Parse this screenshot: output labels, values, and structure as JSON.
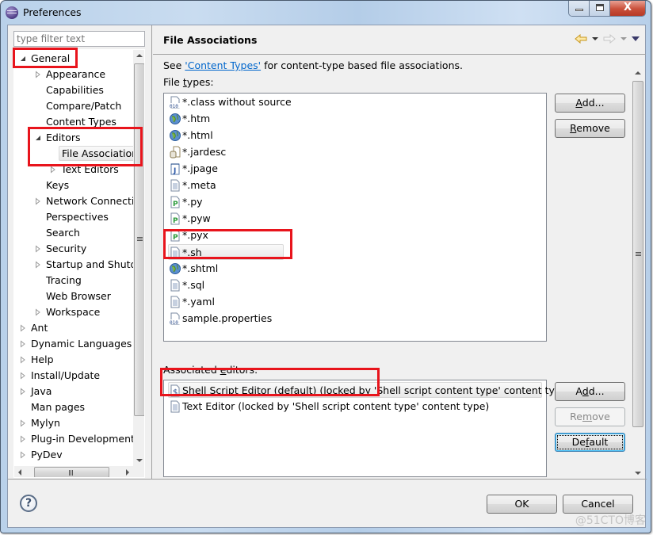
{
  "window": {
    "title": "Preferences",
    "close_glyph": "X"
  },
  "filter": {
    "placeholder": "type filter text"
  },
  "tree": {
    "nodes": [
      {
        "label": "General",
        "level": 0,
        "state": "expanded"
      },
      {
        "label": "Appearance",
        "level": 1,
        "state": "collapsed"
      },
      {
        "label": "Capabilities",
        "level": 1,
        "state": "leaf"
      },
      {
        "label": "Compare/Patch",
        "level": 1,
        "state": "leaf"
      },
      {
        "label": "Content Types",
        "level": 1,
        "state": "leaf"
      },
      {
        "label": "Editors",
        "level": 1,
        "state": "expanded"
      },
      {
        "label": "File Associations",
        "level": 2,
        "state": "leaf",
        "selected": true
      },
      {
        "label": "Text Editors",
        "level": 2,
        "state": "collapsed"
      },
      {
        "label": "Keys",
        "level": 1,
        "state": "leaf"
      },
      {
        "label": "Network Connections",
        "level": 1,
        "state": "collapsed"
      },
      {
        "label": "Perspectives",
        "level": 1,
        "state": "leaf"
      },
      {
        "label": "Search",
        "level": 1,
        "state": "leaf"
      },
      {
        "label": "Security",
        "level": 1,
        "state": "collapsed"
      },
      {
        "label": "Startup and Shutdown",
        "level": 1,
        "state": "collapsed"
      },
      {
        "label": "Tracing",
        "level": 1,
        "state": "leaf"
      },
      {
        "label": "Web Browser",
        "level": 1,
        "state": "leaf"
      },
      {
        "label": "Workspace",
        "level": 1,
        "state": "collapsed"
      },
      {
        "label": "Ant",
        "level": 0,
        "state": "collapsed"
      },
      {
        "label": "Dynamic Languages",
        "level": 0,
        "state": "collapsed"
      },
      {
        "label": "Help",
        "level": 0,
        "state": "collapsed"
      },
      {
        "label": "Install/Update",
        "level": 0,
        "state": "collapsed"
      },
      {
        "label": "Java",
        "level": 0,
        "state": "collapsed"
      },
      {
        "label": "Man pages",
        "level": 0,
        "state": "leaf"
      },
      {
        "label": "Mylyn",
        "level": 0,
        "state": "collapsed"
      },
      {
        "label": "Plug-in Development",
        "level": 0,
        "state": "collapsed"
      },
      {
        "label": "PyDev",
        "level": 0,
        "state": "collapsed"
      }
    ]
  },
  "page": {
    "title": "File Associations",
    "intro_prefix": "See ",
    "intro_link": "'Content Types'",
    "intro_suffix": " for content-type based file associations.",
    "file_types_label": "File types:",
    "file_types_mnemonic": "t",
    "associated_editors_label": "Associated editors:",
    "file_types": [
      {
        "name": "*.class without source",
        "icon": "binary-class-icon"
      },
      {
        "name": "*.htm",
        "icon": "globe-icon"
      },
      {
        "name": "*.html",
        "icon": "globe-icon"
      },
      {
        "name": "*.jardesc",
        "icon": "jar-icon"
      },
      {
        "name": "*.jpage",
        "icon": "java-page-icon"
      },
      {
        "name": "*.meta",
        "icon": "text-file-icon"
      },
      {
        "name": "*.py",
        "icon": "python-file-icon"
      },
      {
        "name": "*.pyw",
        "icon": "python-file-icon"
      },
      {
        "name": "*.pyx",
        "icon": "python-file-icon"
      },
      {
        "name": "*.sh",
        "icon": "text-file-icon",
        "selected": true
      },
      {
        "name": "*.shtml",
        "icon": "globe-icon"
      },
      {
        "name": "*.sql",
        "icon": "text-file-icon"
      },
      {
        "name": "*.yaml",
        "icon": "text-file-icon"
      },
      {
        "name": "sample.properties",
        "icon": "binary-file-icon"
      }
    ],
    "editors": [
      {
        "name": "Shell Script Editor (default) (locked by 'Shell script content type' content type)",
        "icon": "shell-script-icon",
        "selected": true
      },
      {
        "name": "Text Editor (locked by 'Shell script content type' content type)",
        "icon": "text-file-icon"
      }
    ],
    "file_type_buttons": {
      "add": "Add...",
      "remove": "Remove"
    },
    "editor_buttons": {
      "add": "Add...",
      "remove": "Remove",
      "default": "Default"
    }
  },
  "footer": {
    "ok": "OK",
    "cancel": "Cancel",
    "help_glyph": "?"
  },
  "watermark": "@51CTO博客",
  "colors": {
    "highlight_box": "#e8141c",
    "link": "#0066cc"
  }
}
